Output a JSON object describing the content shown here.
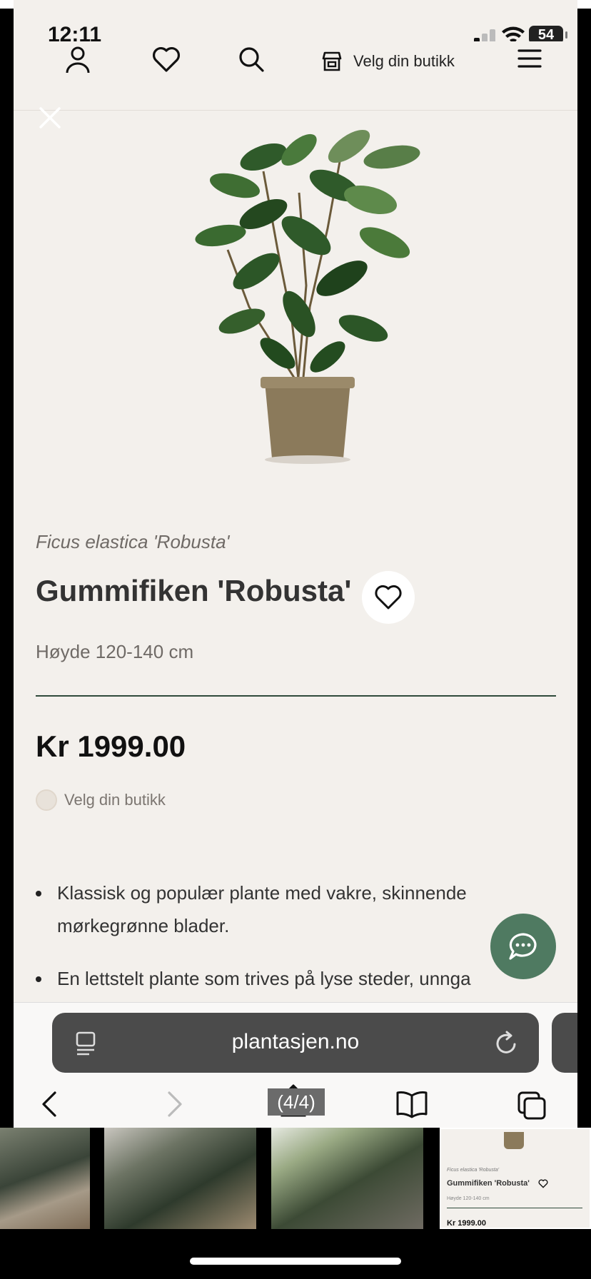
{
  "status": {
    "time": "12:11",
    "battery": "54"
  },
  "nav": {
    "icons": [
      "account-icon",
      "heart-icon",
      "search-icon",
      "store-icon",
      "menu-icon"
    ],
    "store_label": "Velg din butikk"
  },
  "product": {
    "latin_name": "Ficus elastica 'Robusta'",
    "name": "Gummifiken 'Robusta'",
    "height": "Høyde 120-140 cm",
    "price": "Kr 1999.00",
    "store_select": "Velg din butikk",
    "bullets": [
      "Klassisk og populær plante med vakre, skinnende mørkegrønne blader.",
      "En lettstelt plante som trives på lyse steder, unnga"
    ]
  },
  "browser": {
    "url": "plantasjen.no",
    "counter": "(4/4)"
  },
  "thumbnail": {
    "latin": "Ficus elastica 'Robusta'",
    "name": "Gummifiken 'Robusta'",
    "height": "Høyde 120-140 cm",
    "price": "Kr 1999.00"
  },
  "colors": {
    "accent": "#4f7a61",
    "background": "#f3f0ec",
    "rule": "#2f4a3b"
  }
}
